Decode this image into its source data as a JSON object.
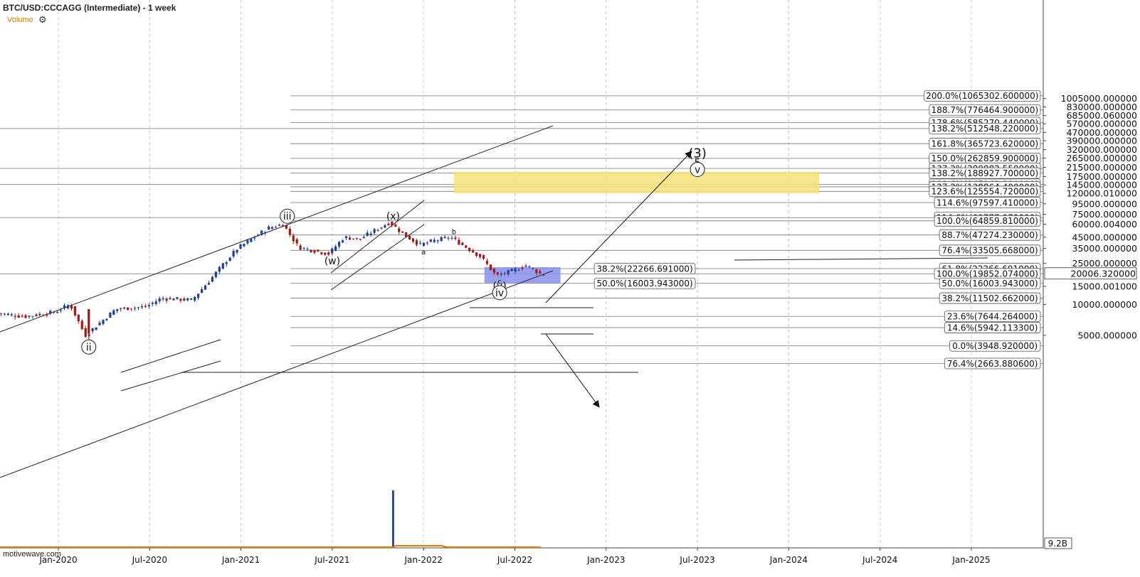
{
  "header": {
    "title": "BTC/USD:CCCAGG (Intermediate) - 1 week"
  },
  "volume_panel": {
    "label": "Volume",
    "settings_icon": "gear-icon",
    "value_label": "9.2B"
  },
  "watermark": "motivewave.com",
  "colors": {
    "bull_candle": "#1f3f9a",
    "bear_candle": "#a01818",
    "target_box": "#f7e27a",
    "support_box": "#8f96ee",
    "volume_line": "#e07b00",
    "grid": "#cccccc"
  },
  "chart_data": {
    "type": "candlestick",
    "title": "BTC/USD:CCCAGG (Intermediate) - 1 week",
    "xlabel": "",
    "ylabel": "",
    "y_scale": "log",
    "grid": true,
    "x_ticks": [
      "Jan-2020",
      "Jul-2020",
      "Jan-2021",
      "Jul-2021",
      "Jan-2022",
      "Jul-2022",
      "Jan-2023",
      "Jul-2023",
      "Jan-2024",
      "Jul-2024",
      "Jan-2025"
    ],
    "y_ticks": [
      "1005000.000000",
      "830000.000000",
      "685000.060000",
      "570000.000000",
      "470000.000000",
      "390000.000000",
      "320000.000000",
      "265000.000000",
      "215000.000000",
      "175000.000000",
      "145000.000000",
      "120000.010000",
      "95000.000000",
      "75000.000000",
      "60000.004000",
      "45000.000000",
      "35000.000000",
      "25000.000000",
      "15000.001000",
      "10000.000000",
      "5000.000000"
    ],
    "last_price_label": "20006.320000",
    "series": [
      {
        "name": "BTC/USD weekly",
        "price_path": [
          [
            "2019-09",
            8300
          ],
          [
            "2019-11",
            7600
          ],
          [
            "2020-01",
            8400
          ],
          [
            "2020-02",
            10000
          ],
          [
            "2020-03",
            5000
          ],
          [
            "2020-05",
            9000
          ],
          [
            "2020-07",
            9500
          ],
          [
            "2020-08",
            11500
          ],
          [
            "2020-10",
            11000
          ],
          [
            "2020-11",
            16000
          ],
          [
            "2020-12",
            24000
          ],
          [
            "2021-01",
            35000
          ],
          [
            "2021-03",
            55000
          ],
          [
            "2021-04",
            60000
          ],
          [
            "2021-05",
            36000
          ],
          [
            "2021-07",
            31000
          ],
          [
            "2021-08",
            45000
          ],
          [
            "2021-09",
            43000
          ],
          [
            "2021-11",
            63000
          ],
          [
            "2021-12",
            47000
          ],
          [
            "2022-01",
            38000
          ],
          [
            "2022-02",
            42000
          ],
          [
            "2022-03",
            45000
          ],
          [
            "2022-05",
            29000
          ],
          [
            "2022-06",
            19000
          ],
          [
            "2022-07",
            21000
          ],
          [
            "2022-08",
            24000
          ],
          [
            "2022-09",
            19500
          ]
        ]
      }
    ],
    "fib_levels_right": [
      {
        "label": "200.0%(1065302.600000)",
        "value": 1065302.6
      },
      {
        "label": "188.7%(776464.900000)",
        "value": 776464.9
      },
      {
        "label": "178.6%(585270.440000)",
        "value": 585270.44
      },
      {
        "label": "138.2%(512548.220000)",
        "value": 512548.22
      },
      {
        "label": "161.8%(365723.620000)",
        "value": 365723.62
      },
      {
        "label": "150.0%(262859.900000)",
        "value": 262859.9
      },
      {
        "label": "137.2%(209982.550000)",
        "value": 209982.55
      },
      {
        "label": "138.2%(188927.700000)",
        "value": 188927.7
      },
      {
        "label": "123.6%(147043.880000)",
        "value": 147043.88
      },
      {
        "label": "127.2%(138864.400000)",
        "value": 138864.4
      },
      {
        "label": "123.6%(125554.720000)",
        "value": 125554.72
      },
      {
        "label": "114.6%(97597.410000)",
        "value": 97597.41
      },
      {
        "label": "114.6%(69777.070000)",
        "value": 69777.07
      },
      {
        "label": "100.0%(64859.810000)",
        "value": 64859.81
      },
      {
        "label": "88.7%(47274.230000)",
        "value": 47274.23
      },
      {
        "label": "76.4%(33505.668000)",
        "value": 33505.668
      },
      {
        "label": "61.8%(22266.691000)",
        "value": 22266.691
      },
      {
        "label": "100.0%(19852.074000)",
        "value": 19852.074
      },
      {
        "label": "50.0%(16003.943000)",
        "value": 16003.943
      },
      {
        "label": "38.2%(11502.662000)",
        "value": 11502.662
      },
      {
        "label": "23.6%(7644.264000)",
        "value": 7644.264
      },
      {
        "label": "14.6%(5942.113300)",
        "value": 5942.1133
      },
      {
        "label": "0.0%(3948.920000)",
        "value": 3948.92
      },
      {
        "label": "76.4%(2663.880600)",
        "value": 2663.8806
      }
    ],
    "fib_levels_mid": [
      {
        "label": "38.2%(22266.691000)",
        "value": 22266.691
      },
      {
        "label": "50.0%(16003.943000)",
        "value": 16003.943
      }
    ],
    "wave_labels": [
      {
        "text": "ii",
        "circled": true,
        "date": "2020-03",
        "value": 3850
      },
      {
        "text": "iii",
        "circled": true,
        "date": "2021-04",
        "value": 72000
      },
      {
        "text": "(w)",
        "circled": false,
        "date": "2021-07",
        "value": 26500
      },
      {
        "text": "(x)",
        "circled": false,
        "date": "2021-11",
        "value": 72000
      },
      {
        "text": "a",
        "circled": false,
        "date": "2022-01",
        "value": 32000
      },
      {
        "text": "b",
        "circled": false,
        "date": "2022-03",
        "value": 50500
      },
      {
        "text": "c",
        "circled": false,
        "date": "2022-06",
        "value": 16600
      },
      {
        "text": "(y)",
        "circled": false,
        "date": "2022-06",
        "value": 15200
      },
      {
        "text": "iv",
        "circled": true,
        "date": "2022-06",
        "value": 13000
      },
      {
        "text": "(3)",
        "circled": false,
        "date": "2023-07",
        "value": 290000
      },
      {
        "text": "5",
        "circled": false,
        "date": "2023-07",
        "value": 240000
      },
      {
        "text": "v",
        "circled": true,
        "date": "2023-07",
        "value": 205000
      }
    ],
    "zones": [
      {
        "name": "target",
        "from": "2022-03",
        "to": "2024-03",
        "low": 120000,
        "high": 195000
      },
      {
        "name": "support",
        "from": "2022-05",
        "to": "2022-10",
        "low": 16000,
        "high": 23000
      }
    ],
    "volume": {
      "spike_date": "2021-11",
      "value_label": "9.2B"
    }
  }
}
